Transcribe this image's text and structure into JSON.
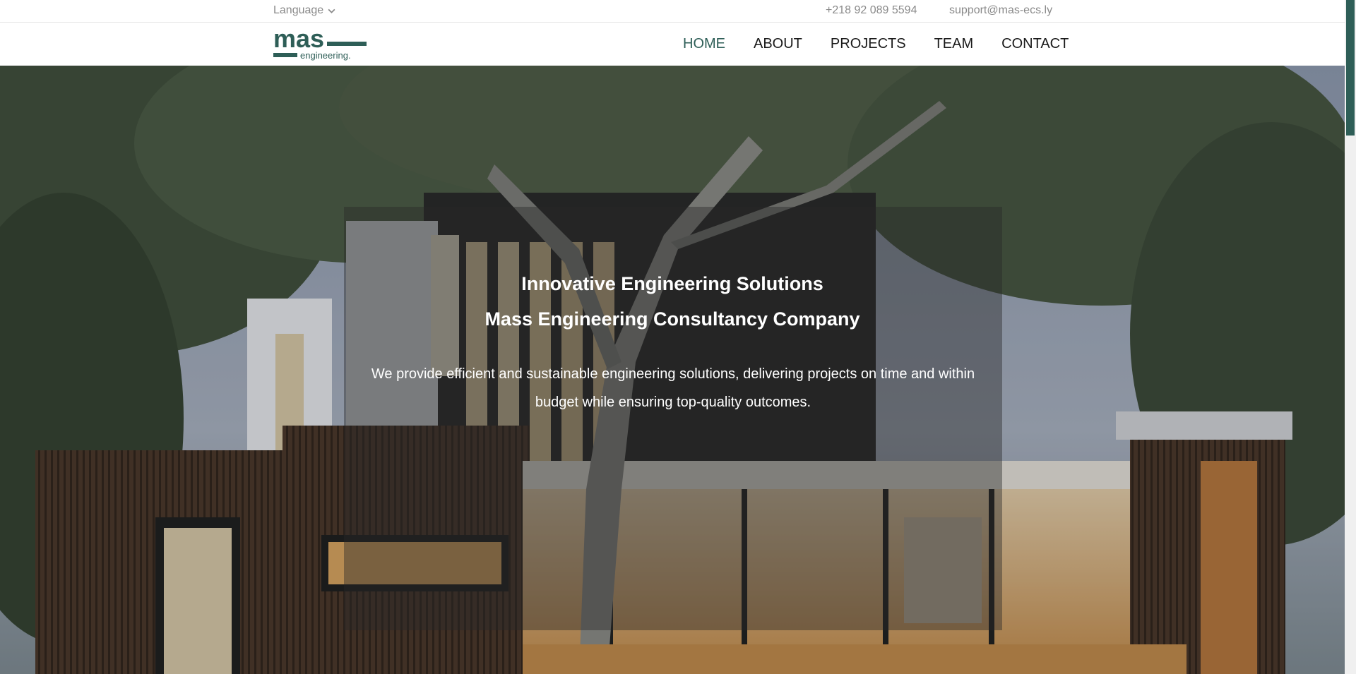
{
  "topbar": {
    "language_label": "Language",
    "phone": "+218 92 089 5594",
    "email": "support@mas-ecs.ly"
  },
  "header": {
    "logo": {
      "main_text": "mas",
      "sub_text": "engineering.",
      "color": "#2e5e57"
    },
    "nav": [
      {
        "label": "HOME",
        "active": true
      },
      {
        "label": "ABOUT",
        "active": false
      },
      {
        "label": "PROJECTS",
        "active": false
      },
      {
        "label": "TEAM",
        "active": false
      },
      {
        "label": "CONTACT",
        "active": false
      }
    ]
  },
  "hero": {
    "title_line1": "Innovative Engineering Solutions",
    "title_line2": "Mass Engineering Consultancy Company",
    "description": "We provide efficient and sustainable engineering solutions, delivering projects on time and within budget while ensuring top-quality outcomes."
  },
  "colors": {
    "brand": "#2e5e57",
    "nav_text": "#1a1a1a",
    "topbar_text": "#8a8a8a"
  }
}
